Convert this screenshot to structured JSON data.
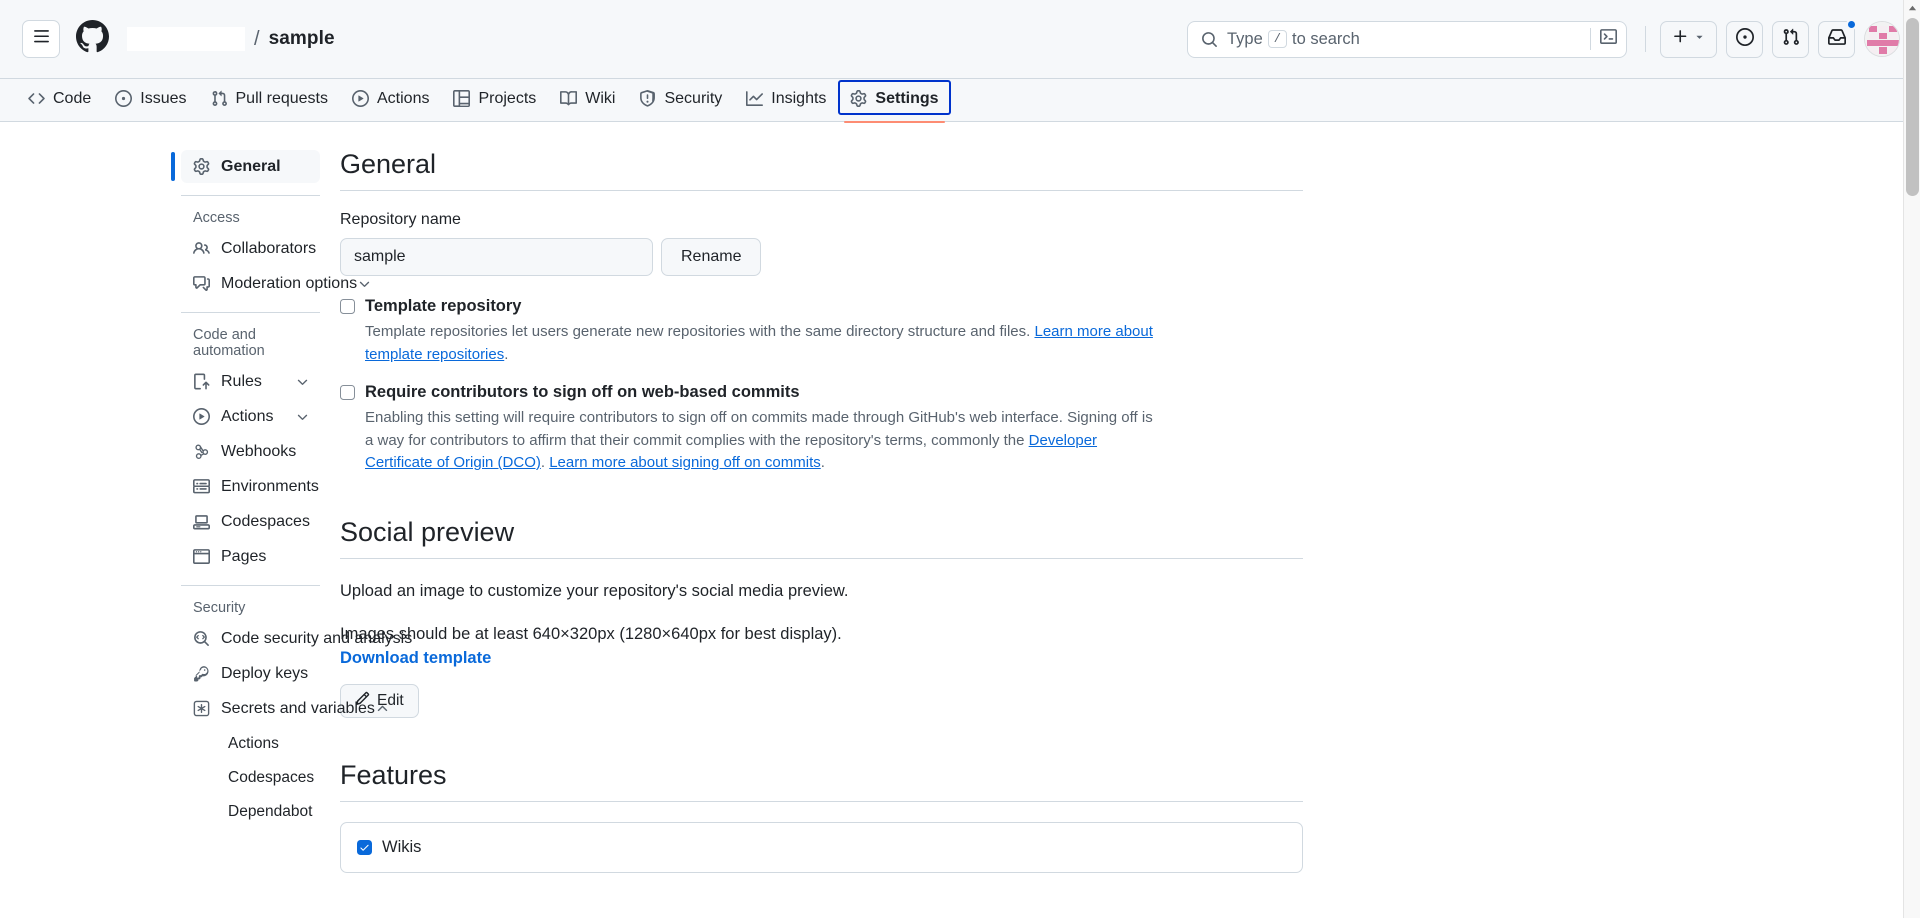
{
  "header": {
    "menu_label": "Open global navigation menu",
    "logo_label": "GitHub",
    "owner": "",
    "separator": "/",
    "repo": "sample",
    "search": {
      "placeholder_prefix": "Type",
      "kbd": "/",
      "placeholder_suffix": "to search",
      "command_palette": "command-palette-icon"
    },
    "actions": {
      "create_label": "Create new...",
      "issues_label": "Your issues",
      "pulls_label": "Your pull requests",
      "inbox_label": "Notifications",
      "avatar_label": "Open user account menu",
      "has_unread": true
    }
  },
  "repo_nav": {
    "items": [
      {
        "label": "Code",
        "icon": "code-icon",
        "active": false
      },
      {
        "label": "Issues",
        "icon": "issue-opened-icon",
        "active": false
      },
      {
        "label": "Pull requests",
        "icon": "git-pull-request-icon",
        "active": false
      },
      {
        "label": "Actions",
        "icon": "play-icon",
        "active": false
      },
      {
        "label": "Projects",
        "icon": "table-icon",
        "active": false
      },
      {
        "label": "Wiki",
        "icon": "book-icon",
        "active": false
      },
      {
        "label": "Security",
        "icon": "shield-icon",
        "active": false
      },
      {
        "label": "Insights",
        "icon": "graph-icon",
        "active": false
      },
      {
        "label": "Settings",
        "icon": "gear-icon",
        "active": true
      }
    ]
  },
  "sidebar": {
    "general": {
      "label": "General",
      "icon": "gear-icon",
      "selected": true
    },
    "groups": [
      {
        "title": "Access",
        "items": [
          {
            "label": "Collaborators",
            "icon": "people-icon",
            "chevron": ""
          },
          {
            "label": "Moderation options",
            "icon": "comment-discussion-icon",
            "chevron": "chevron-down-icon"
          }
        ]
      },
      {
        "title": "Code and automation",
        "items": [
          {
            "label": "Rules",
            "icon": "rules-icon",
            "chevron": "chevron-down-icon"
          },
          {
            "label": "Actions",
            "icon": "play-icon",
            "chevron": "chevron-down-icon"
          },
          {
            "label": "Webhooks",
            "icon": "webhook-icon",
            "chevron": ""
          },
          {
            "label": "Environments",
            "icon": "server-icon",
            "chevron": ""
          },
          {
            "label": "Codespaces",
            "icon": "codespaces-icon",
            "chevron": ""
          },
          {
            "label": "Pages",
            "icon": "browser-icon",
            "chevron": ""
          }
        ]
      },
      {
        "title": "Security",
        "items": [
          {
            "label": "Code security and analysis",
            "icon": "codescan-icon",
            "chevron": ""
          },
          {
            "label": "Deploy keys",
            "icon": "key-icon",
            "chevron": ""
          },
          {
            "label": "Secrets and variables",
            "icon": "asterisk-key-icon",
            "chevron": "chevron-up-icon"
          }
        ],
        "subitems": [
          {
            "label": "Actions"
          },
          {
            "label": "Codespaces"
          },
          {
            "label": "Dependabot"
          }
        ]
      }
    ]
  },
  "main": {
    "general": {
      "title": "General",
      "repo_name_label": "Repository name",
      "repo_name_value": "sample",
      "rename_button": "Rename",
      "template": {
        "checked": false,
        "title": "Template repository",
        "desc": "Template repositories let users generate new repositories with the same directory structure and files.",
        "link": "Learn more about template repositories",
        "trailing": "."
      },
      "signoff": {
        "checked": false,
        "title": "Require contributors to sign off on web-based commits",
        "desc_part1": "Enabling this setting will require contributors to sign off on commits made through GitHub's web interface. Signing off is a way for contributors to affirm that their commit complies with the repository's terms, commonly the ",
        "link1": "Developer Certificate of Origin (DCO)",
        "desc_part2": ". ",
        "link2": "Learn more about signing off on commits",
        "trailing": "."
      }
    },
    "social_preview": {
      "title": "Social preview",
      "line1": "Upload an image to customize your repository's social media preview.",
      "line2": "Images should be at least 640×320px (1280×640px for best display).",
      "download_link": "Download template",
      "edit_button": "Edit"
    },
    "features": {
      "title": "Features",
      "wikis": {
        "label": "Wikis",
        "checked": true
      }
    }
  },
  "colors": {
    "accent": "#0969da",
    "active_tab_underline": "#fd8c73",
    "focus_ring": "#0033cc",
    "header_bg": "#f6f8fa",
    "border": "#d1d9e0",
    "muted_text": "#59636e"
  }
}
